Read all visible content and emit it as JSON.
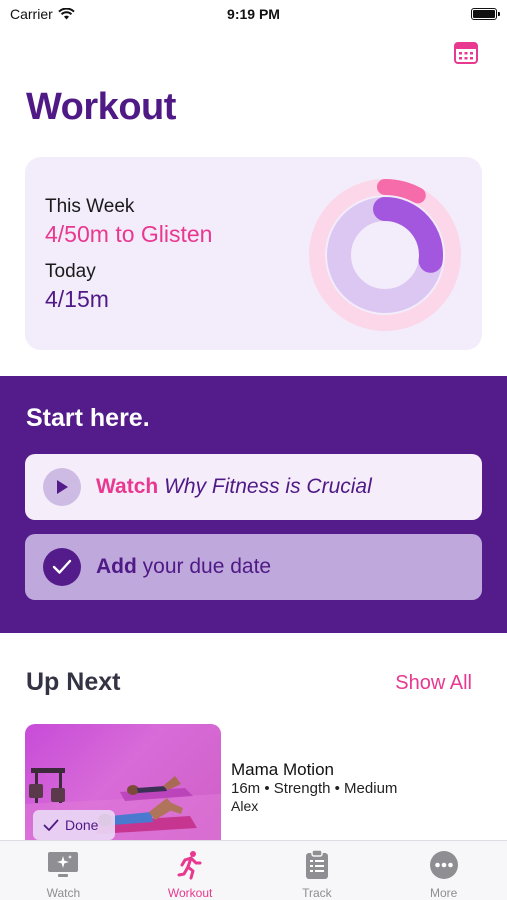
{
  "status_bar": {
    "carrier": "Carrier",
    "time": "9:19 PM"
  },
  "header": {
    "title": "Workout",
    "calendar_icon": "calendar-icon"
  },
  "progress": {
    "week_label": "This Week",
    "week_value": "4/50m to Glisten",
    "today_label": "Today",
    "today_value": "4/15m",
    "week_fraction": 0.08,
    "today_fraction": 0.27
  },
  "start_here": {
    "title": "Start here.",
    "watch_action": "Watch",
    "watch_title": "Why Fitness is Crucial",
    "due_action": "Add",
    "due_text": "your due date"
  },
  "up_next": {
    "title": "Up Next",
    "show_all": "Show All",
    "workout": {
      "name": "Mama Motion",
      "meta": "16m • Strength • Medium",
      "trainer": "Alex",
      "badge": "Done"
    }
  },
  "tabs": [
    {
      "label": "Watch",
      "icon": "tv-sparkle-icon"
    },
    {
      "label": "Workout",
      "icon": "running-figure-icon"
    },
    {
      "label": "Track",
      "icon": "clipboard-icon"
    },
    {
      "label": "More",
      "icon": "more-dots-icon"
    }
  ],
  "colors": {
    "brand_purple": "#541c8a",
    "accent_pink": "#e8388f",
    "card_bg": "#f3ecfb",
    "ring_pink": "#f7a8d0",
    "ring_purple": "#a357de"
  }
}
